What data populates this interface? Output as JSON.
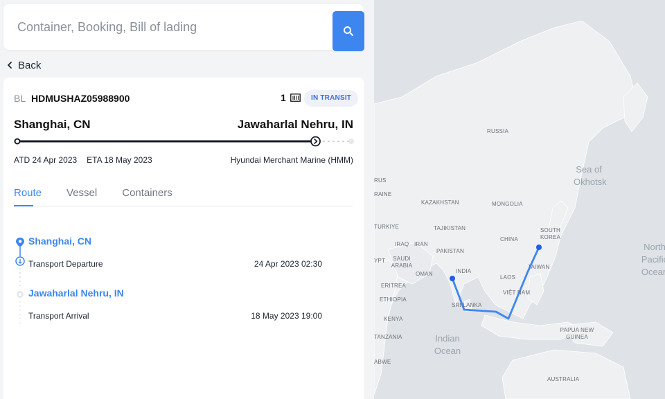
{
  "search": {
    "placeholder": "Container, Booking, Bill of lading",
    "button_icon": "search-icon"
  },
  "nav": {
    "back_label": "Back"
  },
  "shipment": {
    "bl_prefix": "BL",
    "bl_number": "HDMUSHAZ05988900",
    "container_count": "1",
    "status": "IN TRANSIT",
    "origin": "Shanghai, CN",
    "destination": "Jawaharlal Nehru, IN",
    "atd": "ATD 24 Apr 2023",
    "eta": "ETA 18 May 2023",
    "carrier": "Hyundai Merchant Marine (HMM)",
    "progress_fraction": 0.93
  },
  "tabs": [
    {
      "label": "Route",
      "active": true
    },
    {
      "label": "Vessel",
      "active": false
    },
    {
      "label": "Containers",
      "active": false
    }
  ],
  "route": [
    {
      "port": "Shanghai, CN",
      "event": "Transport Departure",
      "datetime": "24 Apr 2023 02:30"
    },
    {
      "port": "Jawaharlal Nehru, IN",
      "event": "Transport Arrival",
      "datetime": "18 May 2023 19:00"
    }
  ],
  "map": {
    "labels": [
      "RUSSIA",
      "KAZAKHSTAN",
      "MONGOLIA",
      "CHINA",
      "SOUTH KOREA",
      "TAJIKISTAN",
      "PAKISTAN",
      "INDIA",
      "IRAQ",
      "IRAN",
      "SAUDI ARABIA",
      "OMAN",
      "ERITREA",
      "ETHIOPIA",
      "KENYA",
      "TANZANIA",
      "LAOS",
      "VIỆT NAM",
      "TAIWAN",
      "SRI LANKA",
      "PAPUA NEW GUINEA",
      "AUSTRALIA",
      "TURKIYE",
      "RAINE",
      "RUS",
      "YPT",
      "ABWE"
    ],
    "oceans": [
      "Indian Ocean",
      "Sea of Okhotsk",
      "North Pacific Ocean"
    ],
    "route_color": "#3d86f0",
    "marker_color": "#1f5fe0"
  },
  "colors": {
    "accent": "#3d86f0",
    "text_dark": "#111111",
    "text_muted": "#8b919b"
  }
}
